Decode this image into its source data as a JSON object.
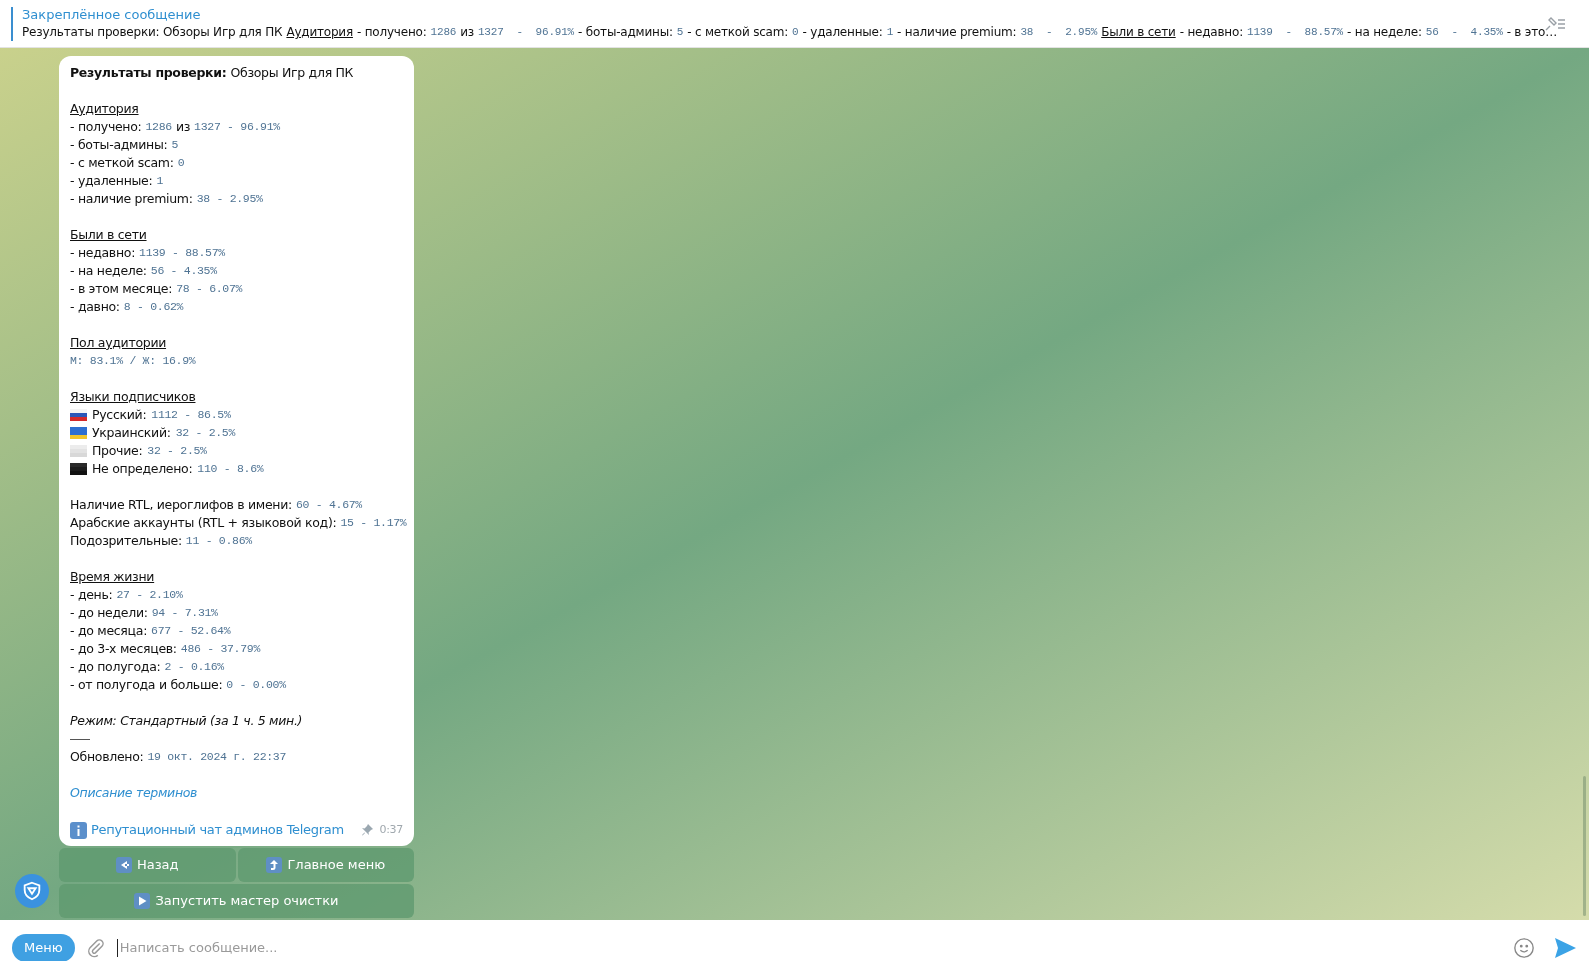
{
  "pinned": {
    "title": "Закреплённое сообщение",
    "preview": [
      {
        "kind": "plain",
        "text": "Результаты проверки: Обзоры Игр для ПК"
      },
      {
        "kind": "heading",
        "text": "Аудитория"
      },
      {
        "kind": "plain",
        "text": "- получено:"
      },
      {
        "kind": "mono",
        "text": "1286"
      },
      {
        "kind": "plain",
        "text": "из"
      },
      {
        "kind": "mono",
        "text": "1327  -  96.91%"
      },
      {
        "kind": "plain",
        "text": "- боты-админы:"
      },
      {
        "kind": "mono",
        "text": "5"
      },
      {
        "kind": "plain",
        "text": "- с меткой scam:"
      },
      {
        "kind": "mono",
        "text": "0"
      },
      {
        "kind": "plain",
        "text": "- удаленные:"
      },
      {
        "kind": "mono",
        "text": "1"
      },
      {
        "kind": "plain",
        "text": "- наличие premium:"
      },
      {
        "kind": "mono",
        "text": "38  -  2.95%"
      },
      {
        "kind": "heading",
        "text": "Были в сети"
      },
      {
        "kind": "plain",
        "text": "- недавно:"
      },
      {
        "kind": "mono",
        "text": "1139  -  88.57%"
      },
      {
        "kind": "plain",
        "text": "- на неделе:"
      },
      {
        "kind": "mono",
        "text": "56  -  4.35%"
      },
      {
        "kind": "plain",
        "text": "- в это…"
      }
    ]
  },
  "message": {
    "lines": [
      {
        "kind": "text",
        "parts": [
          {
            "kind": "bold",
            "text": "Результаты проверки:"
          },
          {
            "kind": "plain",
            "text": "Обзоры Игр для ПК"
          }
        ]
      },
      {
        "kind": "blank"
      },
      {
        "kind": "heading",
        "text": "Аудитория"
      },
      {
        "kind": "text",
        "parts": [
          {
            "kind": "plain",
            "text": "- получено:"
          },
          {
            "kind": "mono",
            "text": "1286"
          },
          {
            "kind": "plain",
            "text": "из"
          },
          {
            "kind": "mono",
            "text": "1327 - 96.91%"
          }
        ]
      },
      {
        "kind": "text",
        "parts": [
          {
            "kind": "plain",
            "text": "- боты-админы:"
          },
          {
            "kind": "mono",
            "text": "5"
          }
        ]
      },
      {
        "kind": "text",
        "parts": [
          {
            "kind": "plain",
            "text": "- с меткой scam:"
          },
          {
            "kind": "mono",
            "text": "0"
          }
        ]
      },
      {
        "kind": "text",
        "parts": [
          {
            "kind": "plain",
            "text": "- удаленные:"
          },
          {
            "kind": "mono",
            "text": "1"
          }
        ]
      },
      {
        "kind": "text",
        "parts": [
          {
            "kind": "plain",
            "text": "- наличие premium:"
          },
          {
            "kind": "mono",
            "text": "38 - 2.95%"
          }
        ]
      },
      {
        "kind": "blank"
      },
      {
        "kind": "heading",
        "text": "Были в сети"
      },
      {
        "kind": "text",
        "parts": [
          {
            "kind": "plain",
            "text": "- недавно:"
          },
          {
            "kind": "mono",
            "text": "1139 - 88.57%"
          }
        ]
      },
      {
        "kind": "text",
        "parts": [
          {
            "kind": "plain",
            "text": "- на неделе:"
          },
          {
            "kind": "mono",
            "text": "56 - 4.35%"
          }
        ]
      },
      {
        "kind": "text",
        "parts": [
          {
            "kind": "plain",
            "text": "- в этом месяце:"
          },
          {
            "kind": "mono",
            "text": "78 - 6.07%"
          }
        ]
      },
      {
        "kind": "text",
        "parts": [
          {
            "kind": "plain",
            "text": "- давно:"
          },
          {
            "kind": "mono",
            "text": "8 - 0.62%"
          }
        ]
      },
      {
        "kind": "blank"
      },
      {
        "kind": "heading",
        "text": "Пол аудитории"
      },
      {
        "kind": "text",
        "parts": [
          {
            "kind": "mono",
            "text": "М: 83.1% / Ж: 16.9%"
          }
        ]
      },
      {
        "kind": "blank"
      },
      {
        "kind": "heading",
        "text": "Языки подписчиков"
      },
      {
        "kind": "flag",
        "parts": [
          {
            "kind": "plain",
            "text": "Русский:"
          },
          {
            "kind": "mono",
            "text": "1112 - 86.5%"
          }
        ]
      },
      {
        "kind": "flag",
        "parts": [
          {
            "kind": "plain",
            "text": "Украинский:"
          },
          {
            "kind": "mono",
            "text": "32 - 2.5%"
          }
        ]
      },
      {
        "kind": "flag",
        "parts": [
          {
            "kind": "plain",
            "text": "Прочие:"
          },
          {
            "kind": "mono",
            "text": "32 - 2.5%"
          }
        ]
      },
      {
        "kind": "flag",
        "parts": [
          {
            "kind": "plain",
            "text": "Не определено:"
          },
          {
            "kind": "mono",
            "text": "110 - 8.6%"
          }
        ]
      },
      {
        "kind": "blank"
      },
      {
        "kind": "text",
        "parts": [
          {
            "kind": "plain",
            "text": "Наличие RTL, иероглифов в имени:"
          },
          {
            "kind": "mono",
            "text": "60 - 4.67%"
          }
        ]
      },
      {
        "kind": "text",
        "parts": [
          {
            "kind": "plain",
            "text": "Арабские аккаунты (RTL + языковой код):"
          },
          {
            "kind": "mono",
            "text": "15 - 1.17%"
          }
        ]
      },
      {
        "kind": "text",
        "parts": [
          {
            "kind": "plain",
            "text": "Подозрительные:"
          },
          {
            "kind": "mono",
            "text": "11 - 0.86%"
          }
        ]
      },
      {
        "kind": "blank"
      },
      {
        "kind": "heading",
        "text": "Время жизни"
      },
      {
        "kind": "text",
        "parts": [
          {
            "kind": "plain",
            "text": "- день:"
          },
          {
            "kind": "mono",
            "text": "27 - 2.10%"
          }
        ]
      },
      {
        "kind": "text",
        "parts": [
          {
            "kind": "plain",
            "text": "- до недели:"
          },
          {
            "kind": "mono",
            "text": "94 - 7.31%"
          }
        ]
      },
      {
        "kind": "text",
        "parts": [
          {
            "kind": "plain",
            "text": "- до месяца:"
          },
          {
            "kind": "mono",
            "text": "677 - 52.64%"
          }
        ]
      },
      {
        "kind": "text",
        "parts": [
          {
            "kind": "plain",
            "text": "- до 3-х месяцев:"
          },
          {
            "kind": "mono",
            "text": "486 - 37.79%"
          }
        ]
      },
      {
        "kind": "text",
        "parts": [
          {
            "kind": "plain",
            "text": "- до полугода:"
          },
          {
            "kind": "mono",
            "text": "2 - 0.16%"
          }
        ]
      },
      {
        "kind": "text",
        "parts": [
          {
            "kind": "plain",
            "text": "- от полугода и больше:"
          },
          {
            "kind": "mono",
            "text": "0 - 0.00%"
          }
        ]
      },
      {
        "kind": "blank"
      },
      {
        "kind": "italic",
        "text": "Режим: Стандартный (за 1 ч. 5 мин.)"
      },
      {
        "kind": "rule"
      },
      {
        "kind": "text",
        "parts": [
          {
            "kind": "plain",
            "text": "Обновлено:"
          },
          {
            "kind": "mono",
            "text": "19 окт. 2024 г. 22:37"
          }
        ]
      },
      {
        "kind": "blank"
      },
      {
        "kind": "link",
        "text": "Описание терминов"
      },
      {
        "kind": "blank"
      }
    ],
    "footer_link": "Репутационный чат админов Telegram",
    "pinned": true,
    "time": "0:37"
  },
  "keyboard": [
    [
      {
        "kind": "back",
        "label": "Назад"
      },
      {
        "kind": "up",
        "label": "Главное меню"
      }
    ],
    [
      {
        "kind": "play",
        "label": "Запустить мастер очистки"
      }
    ]
  ],
  "composer": {
    "menu_button": "Меню",
    "placeholder": "Написать сообщение..."
  }
}
